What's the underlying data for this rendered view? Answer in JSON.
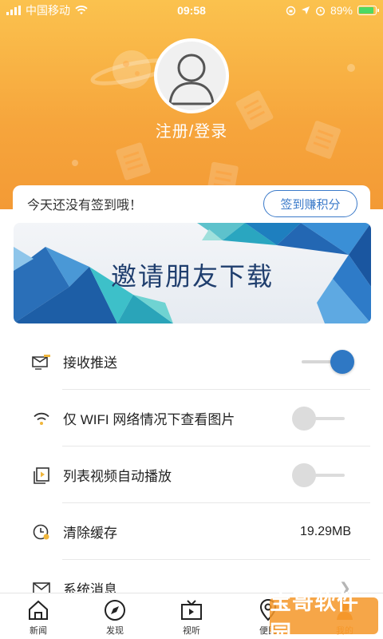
{
  "status_bar": {
    "carrier": "中国移动",
    "time": "09:58",
    "battery": "89%"
  },
  "header": {
    "login_label": "注册/登录"
  },
  "signin": {
    "message": "今天还没有签到哦！",
    "button_label": "签到赚积分"
  },
  "banner": {
    "title": "邀请朋友下载"
  },
  "settings": {
    "push": {
      "label": "接收推送",
      "enabled": true
    },
    "wifi_images": {
      "label": "仅 WIFI 网络情况下查看图片",
      "enabled": false
    },
    "autoplay": {
      "label": "列表视频自动播放",
      "enabled": false
    },
    "cache": {
      "label": "清除缓存",
      "value": "19.29MB"
    },
    "messages": {
      "label": "系统消息"
    }
  },
  "bottom_nav": [
    {
      "label": "新闻",
      "icon": "home-icon"
    },
    {
      "label": "发现",
      "icon": "compass-icon"
    },
    {
      "label": "视听",
      "icon": "tv-icon"
    },
    {
      "label": "便民",
      "icon": "location-icon"
    },
    {
      "label": "我的",
      "icon": "user-icon"
    }
  ],
  "watermark": {
    "text": "宝哥软件园"
  },
  "colors": {
    "header_orange": "#f6a53c",
    "accent_blue": "#2f78c4",
    "button_blue": "#3b7ac9"
  }
}
